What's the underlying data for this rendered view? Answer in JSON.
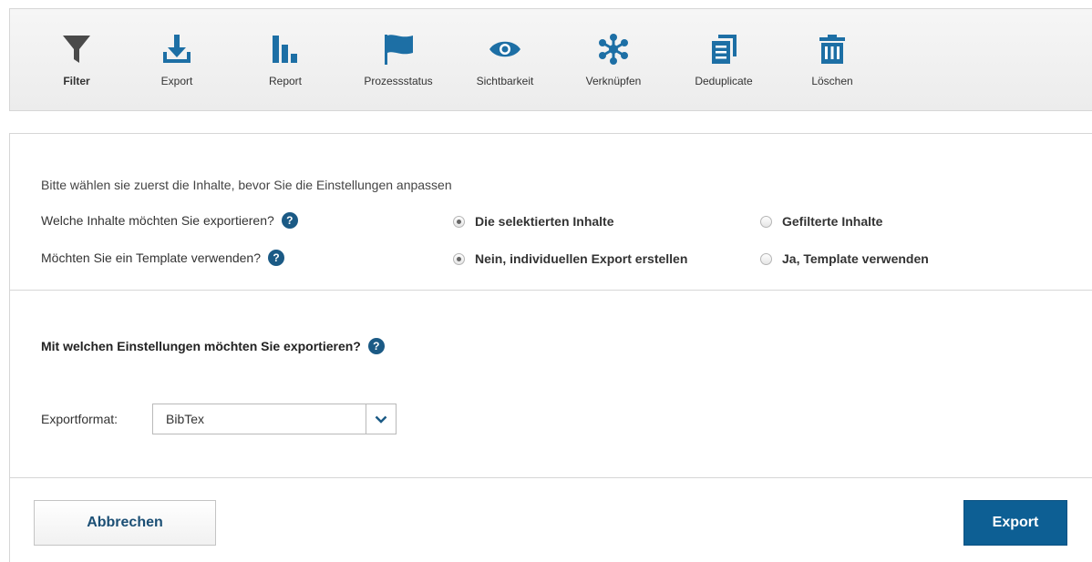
{
  "toolbar": {
    "items": [
      {
        "label": "Filter",
        "icon": "filter-icon"
      },
      {
        "label": "Export",
        "icon": "download-icon"
      },
      {
        "label": "Report",
        "icon": "bar-chart-icon"
      },
      {
        "label": "Prozessstatus",
        "icon": "flag-icon"
      },
      {
        "label": "Sichtbarkeit",
        "icon": "eye-icon"
      },
      {
        "label": "Verknüpfen",
        "icon": "network-icon"
      },
      {
        "label": "Deduplicate",
        "icon": "copy-documents-icon"
      },
      {
        "label": "Löschen",
        "icon": "trash-icon"
      }
    ]
  },
  "content_selection": {
    "hint": "Bitte wählen sie zuerst die Inhalte, bevor Sie die Einstellungen anpassen",
    "question": "Welche Inhalte möchten Sie exportieren?",
    "options": [
      {
        "label": "Die selektierten Inhalte",
        "selected": true
      },
      {
        "label": "Gefilterte Inhalte",
        "selected": false
      }
    ]
  },
  "template_selection": {
    "question": "Möchten Sie ein Template verwenden?",
    "options": [
      {
        "label": "Nein, individuellen Export erstellen",
        "selected": true
      },
      {
        "label": "Ja, Template verwenden",
        "selected": false
      }
    ]
  },
  "settings": {
    "title": "Mit welchen Einstellungen möchten Sie exportieren?",
    "format_label": "Exportformat:",
    "format_value": "BibTex"
  },
  "help_glyph": "?",
  "actions": {
    "cancel_label": "Abbrechen",
    "export_label": "Export"
  },
  "colors": {
    "accent": "#0d5f94",
    "help_icon": "#1b5a85",
    "cancel_text": "#1b4f75"
  }
}
